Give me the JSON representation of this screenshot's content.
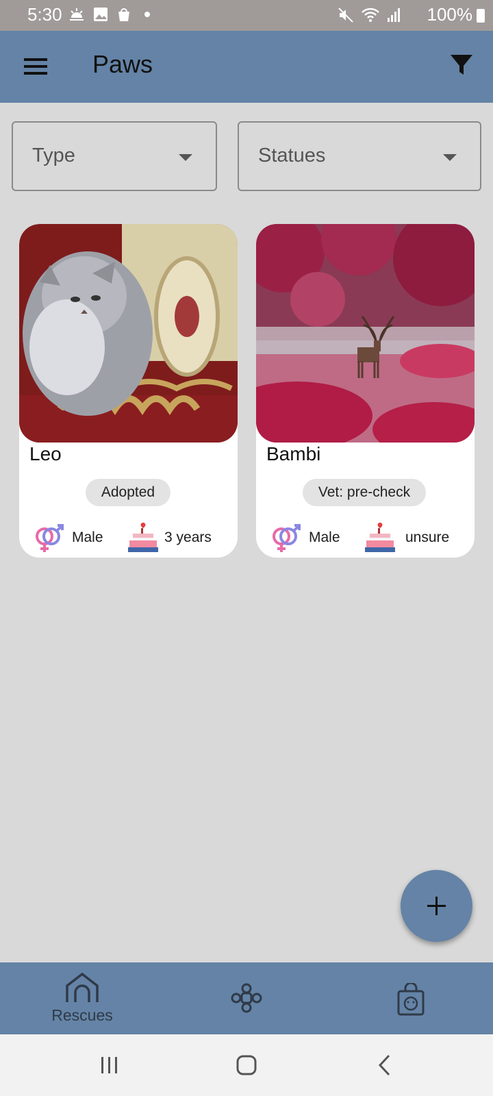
{
  "status_bar": {
    "time": "5:30",
    "battery": "100%"
  },
  "app_bar": {
    "title": "Paws",
    "menu_icon": "hamburger-menu-icon",
    "filter_icon": "filter-icon"
  },
  "filters": {
    "type_label": "Type",
    "status_label": "Statues"
  },
  "pets": [
    {
      "name": "Leo",
      "status": "Adopted",
      "gender": "Male",
      "age": "3 years",
      "photo": "cat-photo"
    },
    {
      "name": "Bambi",
      "status": "Vet: pre-check",
      "gender": "Male",
      "age": "unsure",
      "photo": "deer-photo"
    }
  ],
  "bottom_nav": {
    "items": [
      {
        "label": "Rescues",
        "icon": "shelter-icon"
      },
      {
        "label": "",
        "icon": "paw-icon"
      },
      {
        "label": "",
        "icon": "shopping-bag-icon"
      }
    ]
  },
  "colors": {
    "primary": "#6483a6",
    "background": "#d9d9d9",
    "status_bar": "#a09a99"
  }
}
